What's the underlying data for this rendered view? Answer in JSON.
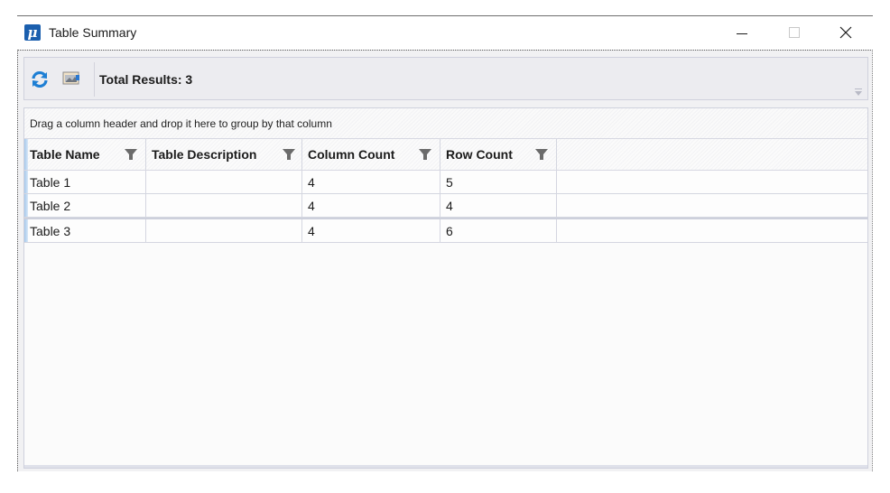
{
  "window": {
    "title": "Table Summary",
    "app_icon": "mu-app-icon",
    "controls": [
      "minimize",
      "maximize",
      "close"
    ]
  },
  "toolbar": {
    "refresh_icon": "refresh-icon",
    "export_icon": "export-image-icon",
    "total_results": "Total Results: 3"
  },
  "grid": {
    "group_panel_text": "Drag a column header and drop it here to group by that column",
    "columns": [
      {
        "label": "Table Name",
        "filter_icon": "filter-icon"
      },
      {
        "label": "Table Description",
        "filter_icon": "filter-icon"
      },
      {
        "label": "Column Count",
        "filter_icon": "filter-icon"
      },
      {
        "label": "Row Count",
        "filter_icon": "filter-icon"
      }
    ],
    "rows": [
      {
        "name": "Table 1",
        "description": "",
        "column_count": "4",
        "row_count": "5"
      },
      {
        "name": "Table 2",
        "description": "",
        "column_count": "4",
        "row_count": "4"
      },
      {
        "name": "Table 3",
        "description": "",
        "column_count": "4",
        "row_count": "6"
      }
    ]
  },
  "colors": {
    "app_icon": "#1b5fae",
    "refresh_icon": "#1e7fd4",
    "filter_icon": "#6b6b6b",
    "row_indicator": "#a6c8ec"
  }
}
